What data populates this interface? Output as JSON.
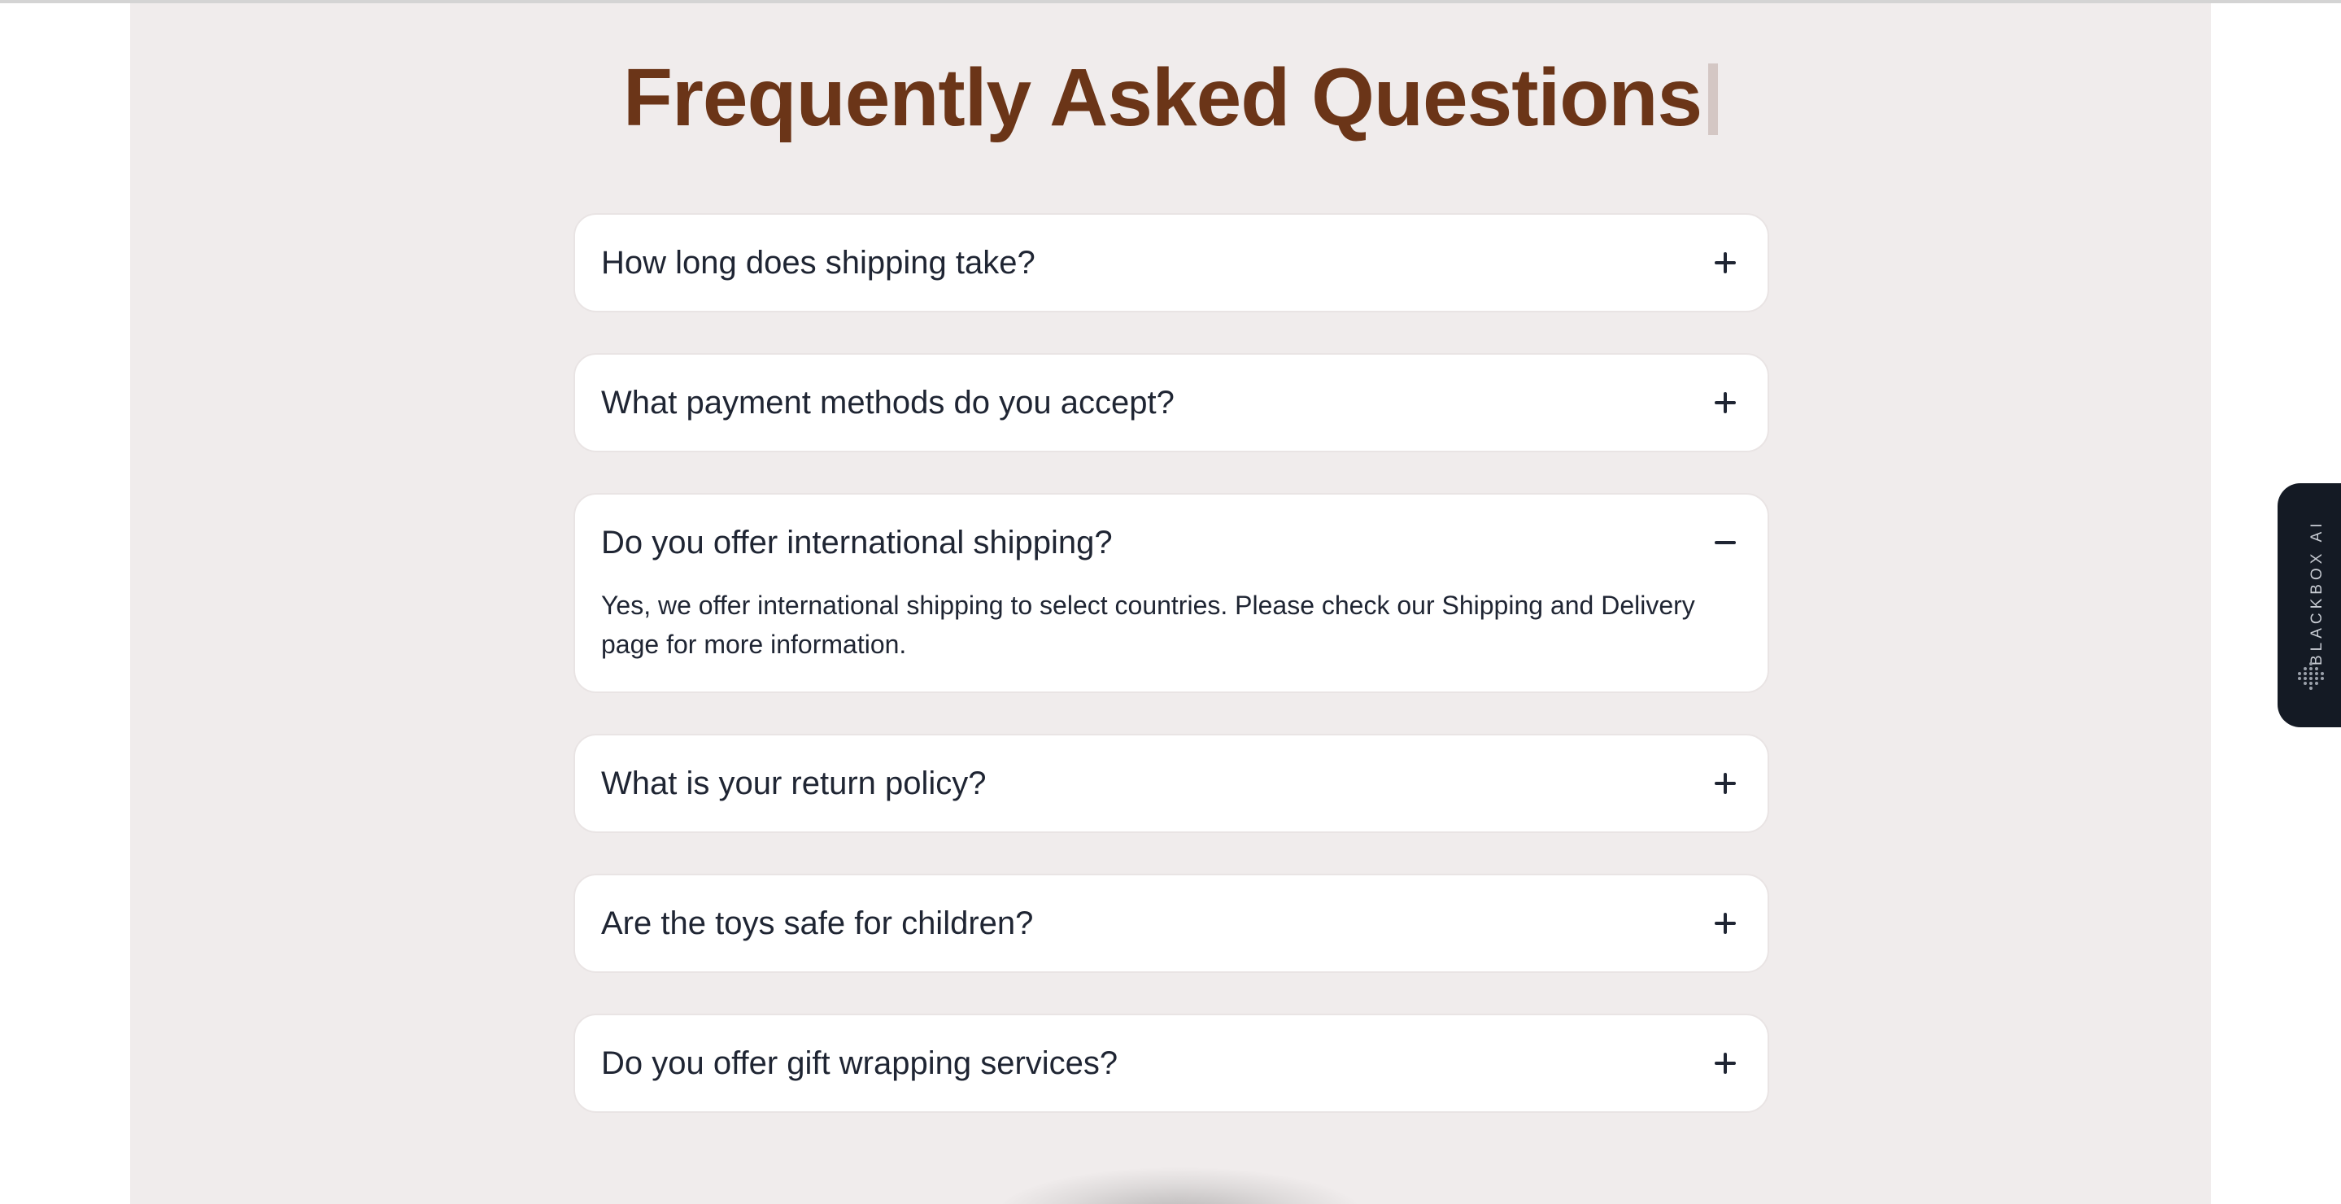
{
  "page": {
    "title": "Frequently Asked Questions"
  },
  "faq": {
    "items": [
      {
        "question": "How long does shipping take?",
        "expanded": false,
        "toggle_icon": "plus-icon"
      },
      {
        "question": "What payment methods do you accept?",
        "expanded": false,
        "toggle_icon": "plus-icon"
      },
      {
        "question": "Do you offer international shipping?",
        "expanded": true,
        "toggle_icon": "minus-icon",
        "answer": "Yes, we offer international shipping to select countries. Please check our Shipping and Delivery page for more information."
      },
      {
        "question": "What is your return policy?",
        "expanded": false,
        "toggle_icon": "plus-icon"
      },
      {
        "question": "Are the toys safe for children?",
        "expanded": false,
        "toggle_icon": "plus-icon"
      },
      {
        "question": "Do you offer gift wrapping services?",
        "expanded": false,
        "toggle_icon": "plus-icon"
      }
    ]
  },
  "side_tab": {
    "label": "BLACKBOX AI",
    "icon": "dot-grid-logo-icon"
  },
  "colors": {
    "title": "#6b3518",
    "section_background": "#f0ecec",
    "card_background": "#ffffff",
    "text": "#1f2533",
    "side_tab_background": "#141a24"
  }
}
